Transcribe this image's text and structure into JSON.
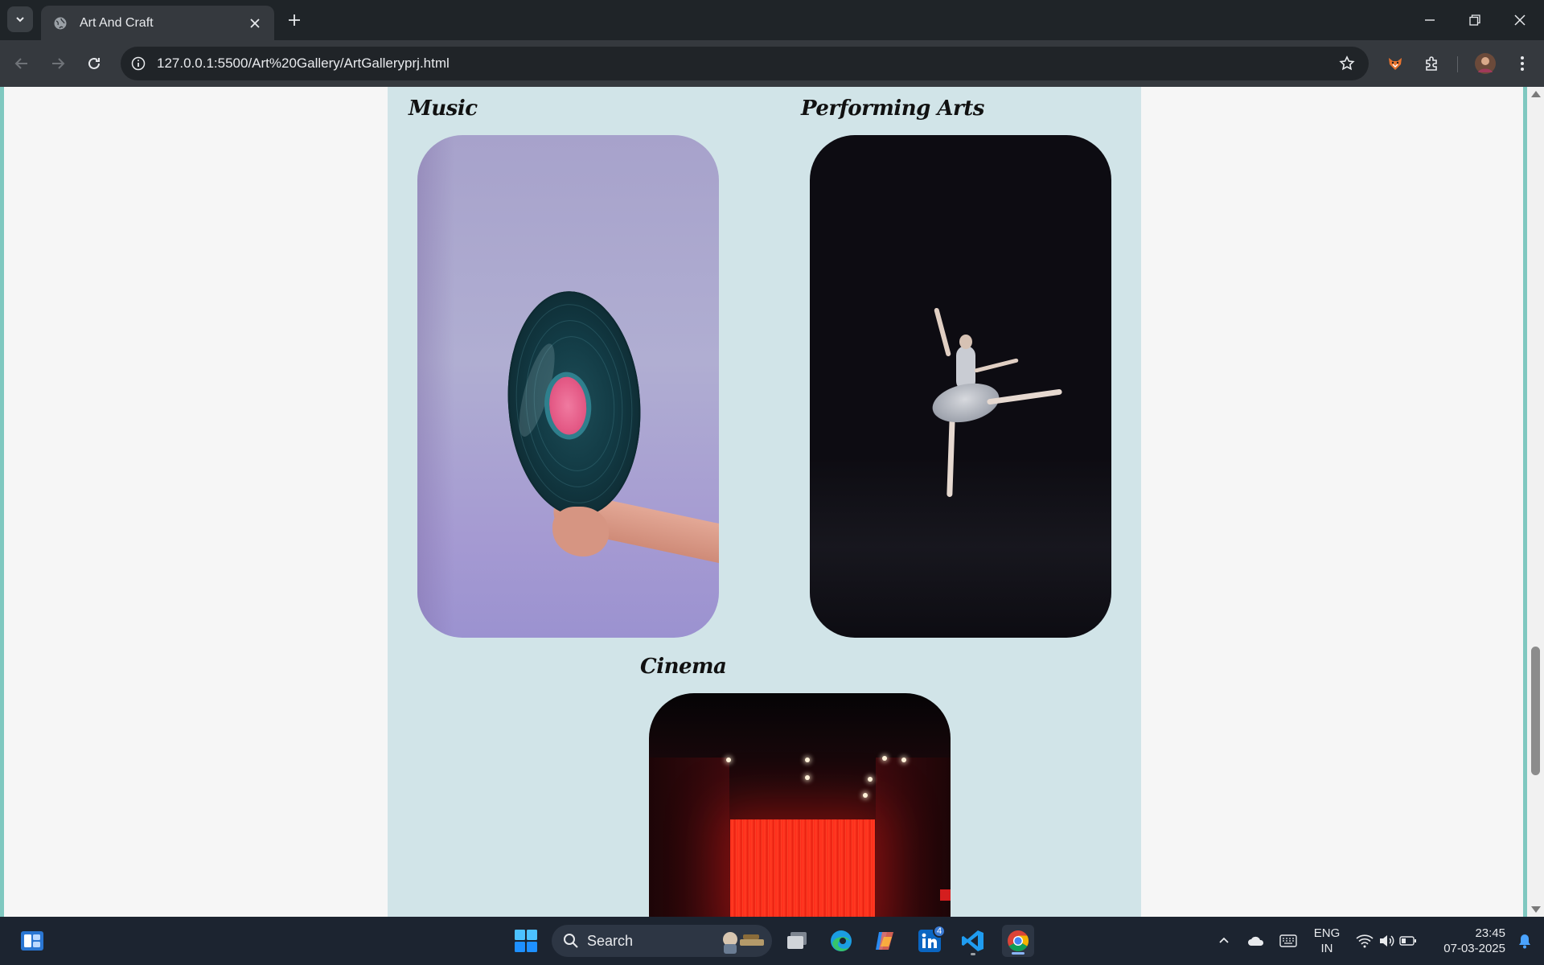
{
  "browser": {
    "tab_title": "Art And Craft",
    "url": "127.0.0.1:5500/Art%20Gallery/ArtGalleryprj.html"
  },
  "gallery": {
    "sections": [
      {
        "title": "Music",
        "image": "vinyl-record-photo"
      },
      {
        "title": "Performing Arts",
        "image": "ballet-dancer-photo"
      },
      {
        "title": "Cinema",
        "image": "cinema-screen-photo"
      }
    ],
    "colors": {
      "panel": "#d1e4e8",
      "page_bg": "#f6f6f6",
      "accent_edge": "#7fc8c0"
    }
  },
  "taskbar": {
    "search_label": "Search",
    "linkedin_badge": "4",
    "lang_line1": "ENG",
    "lang_line2": "IN",
    "time": "23:45",
    "date": "07-03-2025"
  }
}
